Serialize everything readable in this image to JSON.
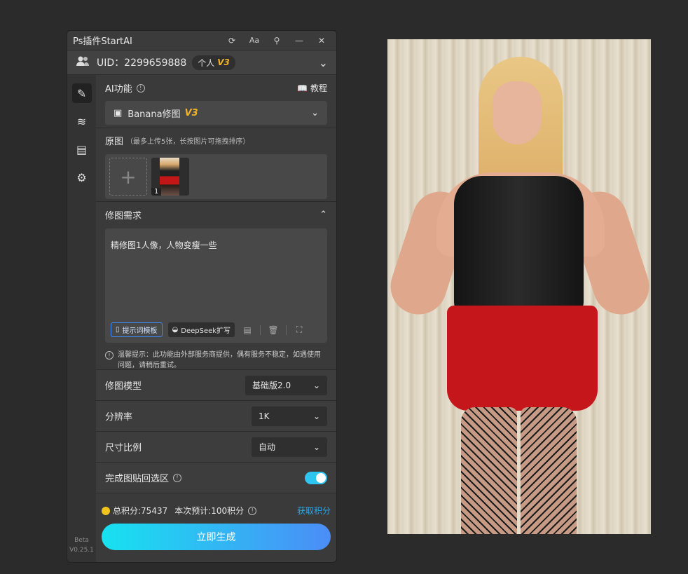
{
  "window": {
    "title": "Ps插件StartAI",
    "buttons": [
      "refresh-icon",
      "font-size-icon",
      "pin-icon",
      "minimize-icon",
      "close-icon"
    ]
  },
  "user": {
    "uid_text": "UID：2299659888",
    "badge_label": "个人",
    "badge_version": "V3"
  },
  "sidebar": {
    "items": [
      "edit-icon",
      "layers-icon",
      "clipboard-icon",
      "settings-icon"
    ],
    "version_line1": "Beta",
    "version_line2": "V0.25.1"
  },
  "ai_function": {
    "label": "AI功能",
    "tutorial_label": "教程",
    "selected_model": "Banana修图",
    "selected_version": "V3"
  },
  "original": {
    "label": "原图",
    "hint": "（最多上传5张，长按图片可拖拽排序）",
    "thumb_index": "1"
  },
  "requirement": {
    "label": "修图需求",
    "text": "精修图1人像，人物变瘦一些",
    "template_button": "提示词模板",
    "deepseek_button": "DeepSeek扩写",
    "notice": "温馨提示：此功能由外部服务商提供，偶有服务不稳定，如遇使用问题，请稍后重试。"
  },
  "options": {
    "model_label": "修图模型",
    "model_value": "基础版2.0",
    "resolution_label": "分辨率",
    "resolution_value": "1K",
    "ratio_label": "尺寸比例",
    "ratio_value": "自动",
    "paste_back_label": "完成图贴回选区",
    "paste_back_enabled": true
  },
  "footer": {
    "credits_total": "总积分:75437",
    "credits_estimate": "本次预计:100积分",
    "get_credits": "获取积分",
    "generate_button": "立即生成"
  },
  "colors": {
    "accent_blue": "#2aa6e8",
    "gradient_start": "#17e2f0",
    "gradient_end": "#4b8df7",
    "version_gold": "#f0b429"
  }
}
